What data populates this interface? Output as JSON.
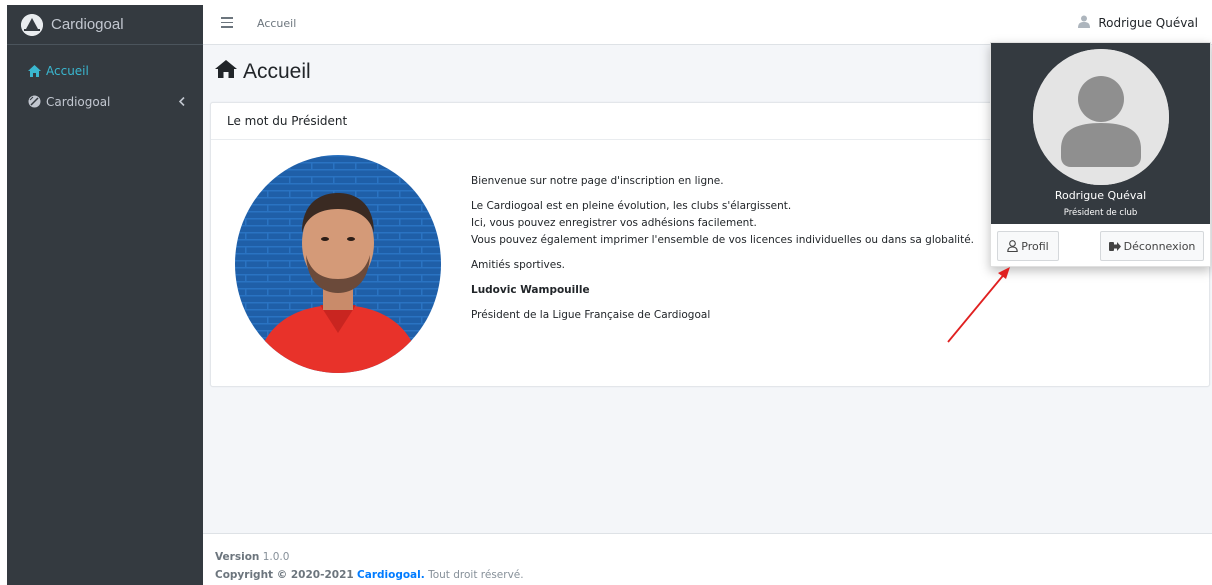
{
  "app": {
    "brand": "Cardiogoal"
  },
  "sidebar": {
    "items": [
      {
        "label": "Accueil",
        "icon": "home-icon",
        "active": true
      },
      {
        "label": "Cardiogoal",
        "icon": "ball-icon",
        "active": false
      }
    ]
  },
  "topbar": {
    "breadcrumb": "Accueil",
    "user_name": "Rodrigue Quéval"
  },
  "page": {
    "title": "Accueil"
  },
  "card": {
    "header": "Le mot du Président",
    "paragraphs": {
      "p1": "Bienvenue sur notre page d'inscription en ligne.",
      "p2_l1": "Le Cardiogoal est en pleine évolution, les clubs s'élargissent.",
      "p2_l2": "Ici, vous pouvez enregistrer vos adhésions facilement.",
      "p2_l3": "Vous pouvez également imprimer l'ensemble de vos licences individuelles ou dans sa globalité.",
      "p3": "Amitiés sportives.",
      "signature": "Ludovic Wampouille",
      "signature_title": "Président de la Ligue Française de Cardiogoal"
    }
  },
  "footer": {
    "version_label": "Version",
    "version": "1.0.0",
    "copyright": "Copyright © 2020-2021",
    "brand_link": "Cardiogoal.",
    "rights": "Tout droit réservé."
  },
  "dropdown": {
    "name": "Rodrigue Quéval",
    "role": "Président de club",
    "profile_label": "Profil",
    "logout_label": "Déconnexion"
  },
  "colors": {
    "sidebar_bg": "#343a40",
    "active_nav": "#3ab7d0",
    "link": "#007bff",
    "annotation_arrow": "#e02020"
  }
}
